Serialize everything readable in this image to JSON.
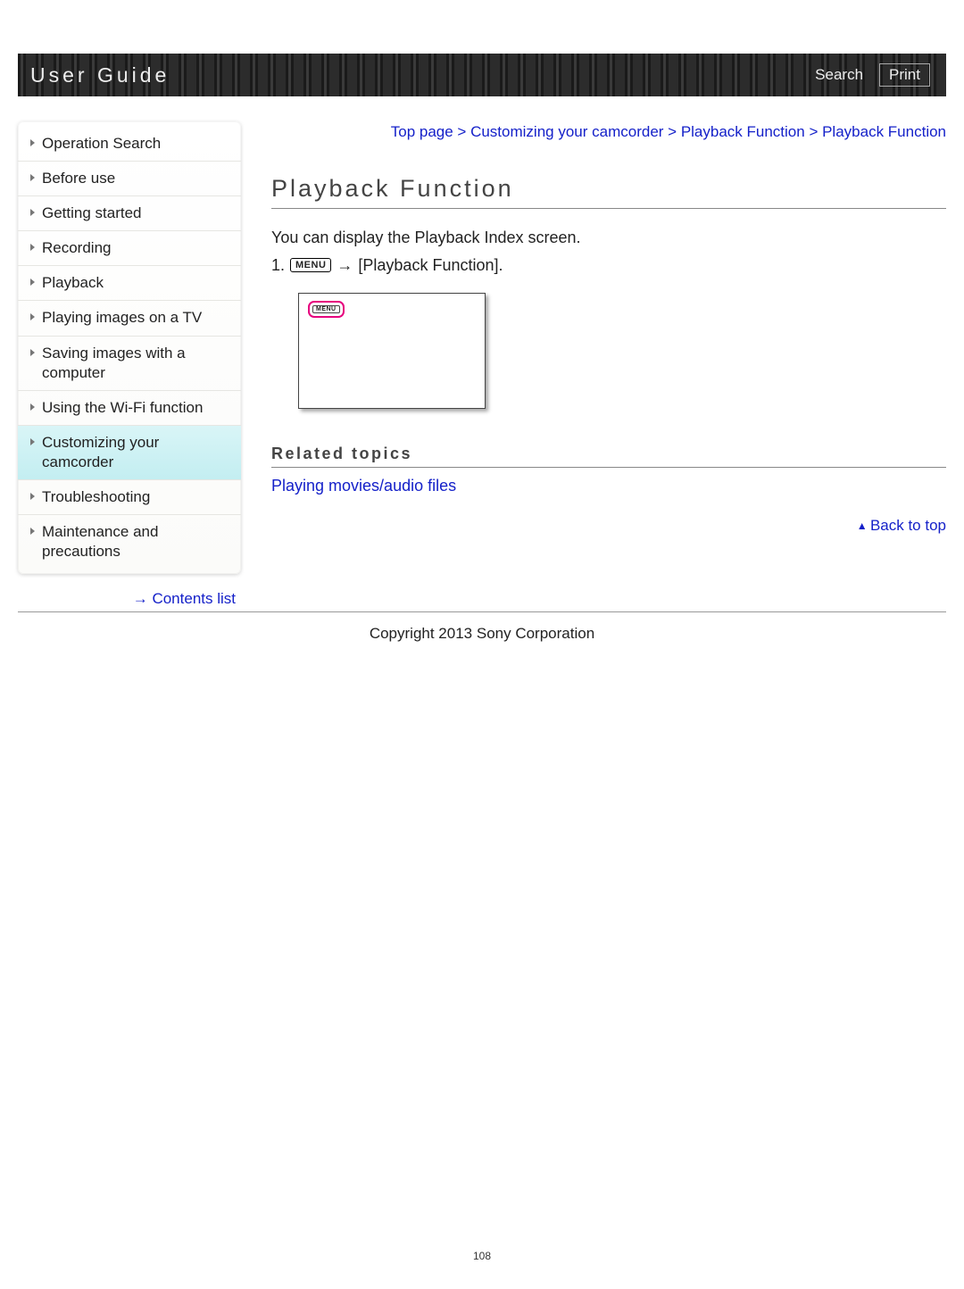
{
  "header": {
    "title": "User Guide",
    "search": "Search",
    "print": "Print"
  },
  "sidebar": {
    "items": [
      {
        "label": "Operation Search",
        "active": false
      },
      {
        "label": "Before use",
        "active": false
      },
      {
        "label": "Getting started",
        "active": false
      },
      {
        "label": "Recording",
        "active": false
      },
      {
        "label": "Playback",
        "active": false
      },
      {
        "label": "Playing images on a TV",
        "active": false
      },
      {
        "label": "Saving images with a computer",
        "active": false
      },
      {
        "label": "Using the Wi-Fi function",
        "active": false
      },
      {
        "label": "Customizing your camcorder",
        "active": true
      },
      {
        "label": "Troubleshooting",
        "active": false
      },
      {
        "label": "Maintenance and precautions",
        "active": false
      }
    ],
    "contents_link": "Contents list"
  },
  "breadcrumb": {
    "parts": [
      "Top page",
      "Customizing your camcorder",
      "Playback Function",
      "Playback Function"
    ],
    "sep": " > "
  },
  "main": {
    "title": "Playback Function",
    "intro": "You can display the Playback Index screen.",
    "step_num": "1.",
    "menu_label": "MENU",
    "arrow": "→",
    "step_target": "[Playback Function].",
    "illus_menu": "MENU",
    "related_heading": "Related topics",
    "related_link": "Playing movies/audio files",
    "back_to_top": "Back to top"
  },
  "footer": {
    "copyright": "Copyright 2013 Sony Corporation",
    "page_number": "108"
  }
}
